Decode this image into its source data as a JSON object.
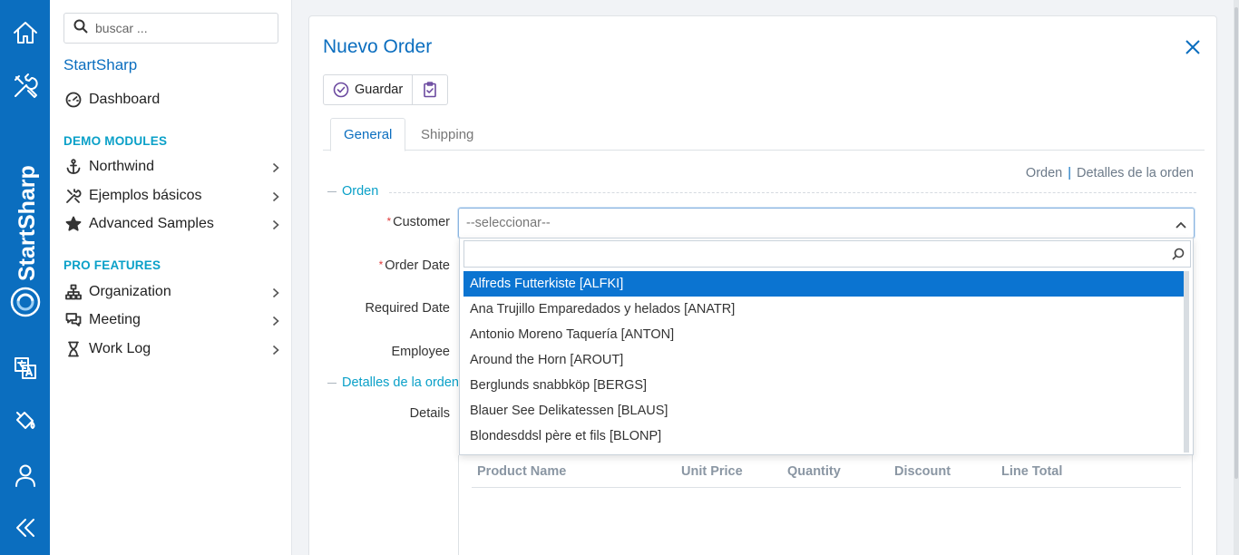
{
  "rail": {
    "icons": [
      "home-icon",
      "tools-icon",
      "translate-icon",
      "paint-bucket-icon",
      "user-icon",
      "collapse-icon"
    ],
    "brand_text": "StartSharp"
  },
  "sidebar": {
    "search_placeholder": "buscar ...",
    "title": "StartSharp",
    "dashboard": "Dashboard",
    "section_demo": "DEMO MODULES",
    "demo_items": [
      {
        "label": "Northwind",
        "icon": "anchor-icon"
      },
      {
        "label": "Ejemplos básicos",
        "icon": "tools-icon"
      },
      {
        "label": "Advanced Samples",
        "icon": "star-icon"
      }
    ],
    "section_pro": "PRO FEATURES",
    "pro_items": [
      {
        "label": "Organization",
        "icon": "sitemap-icon"
      },
      {
        "label": "Meeting",
        "icon": "chat-icon"
      },
      {
        "label": "Work Log",
        "icon": "hourglass-icon"
      }
    ]
  },
  "dialog": {
    "title": "Nuevo Order",
    "save_label": "Guardar",
    "tabs": [
      "General",
      "Shipping"
    ],
    "section_links": [
      "Orden",
      "Detalles de la orden"
    ],
    "category_orden": "Orden",
    "category_detalles": "Detalles de la orden",
    "labels": {
      "customer": "Customer",
      "order_date": "Order Date",
      "required_date": "Required Date",
      "employee": "Employee",
      "details": "Details"
    },
    "customer_select": {
      "placeholder": "--seleccionar--",
      "search_value": "",
      "options": [
        "Alfreds Futterkiste [ALFKI]",
        "Ana Trujillo Emparedados y helados [ANATR]",
        "Antonio Moreno Taquería [ANTON]",
        "Around the Horn [AROUT]",
        "Berglunds snabbköp [BERGS]",
        "Blauer See Delikatessen [BLAUS]",
        "Blondesddsl père et fils [BLONP]"
      ],
      "highlighted_index": 0
    },
    "grid_columns": [
      "Product Name",
      "Unit Price",
      "Quantity",
      "Discount",
      "Line Total"
    ]
  },
  "colors": {
    "accent": "#0b6ebf",
    "section": "#0aa0c8",
    "highlight": "#0b74d1",
    "required": "#e03a3a"
  }
}
